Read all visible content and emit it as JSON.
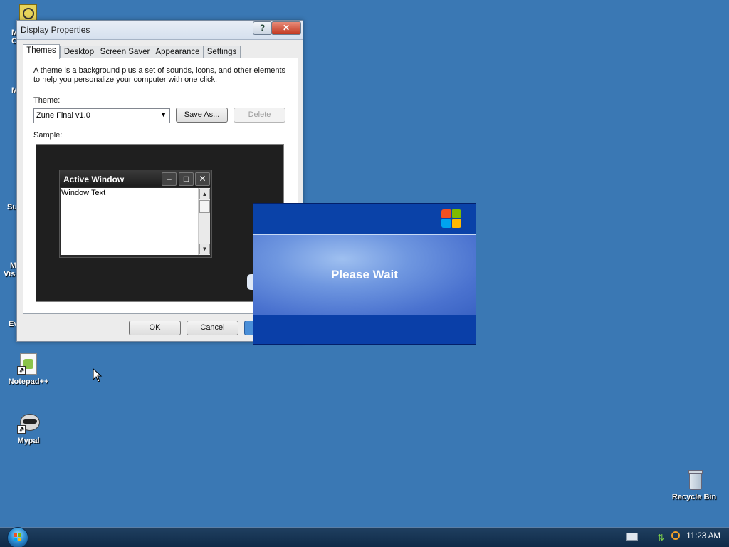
{
  "desktop": {
    "icons": [
      {
        "label": "Notepad++"
      },
      {
        "label": "Mypal"
      },
      {
        "label": "Recycle Bin"
      }
    ],
    "partial_labels": [
      "M",
      "C",
      "M",
      "Su",
      "M",
      "Visi",
      "Ev"
    ]
  },
  "display_properties": {
    "title": "Display Properties",
    "help_label": "?",
    "close_label": "✕",
    "tabs": [
      "Themes",
      "Desktop",
      "Screen Saver",
      "Appearance",
      "Settings"
    ],
    "intro": "A theme is a background plus a set of sounds, icons, and other elements to help you personalize your computer with one click.",
    "theme_label": "Theme:",
    "theme_value": "Zune Final v1.0",
    "save_as": "Save As...",
    "delete": "Delete",
    "sample_label": "Sample:",
    "sample_window": {
      "title": "Active Window",
      "text": "Window Text"
    },
    "ok": "OK",
    "cancel": "Cancel"
  },
  "splash": {
    "message": "Please Wait"
  },
  "taskbar": {
    "clock": "11:23 AM"
  },
  "colors": {
    "desktop": "#3a78b4",
    "taskbar": "#143556",
    "splash_blue": "#0a42a8"
  }
}
